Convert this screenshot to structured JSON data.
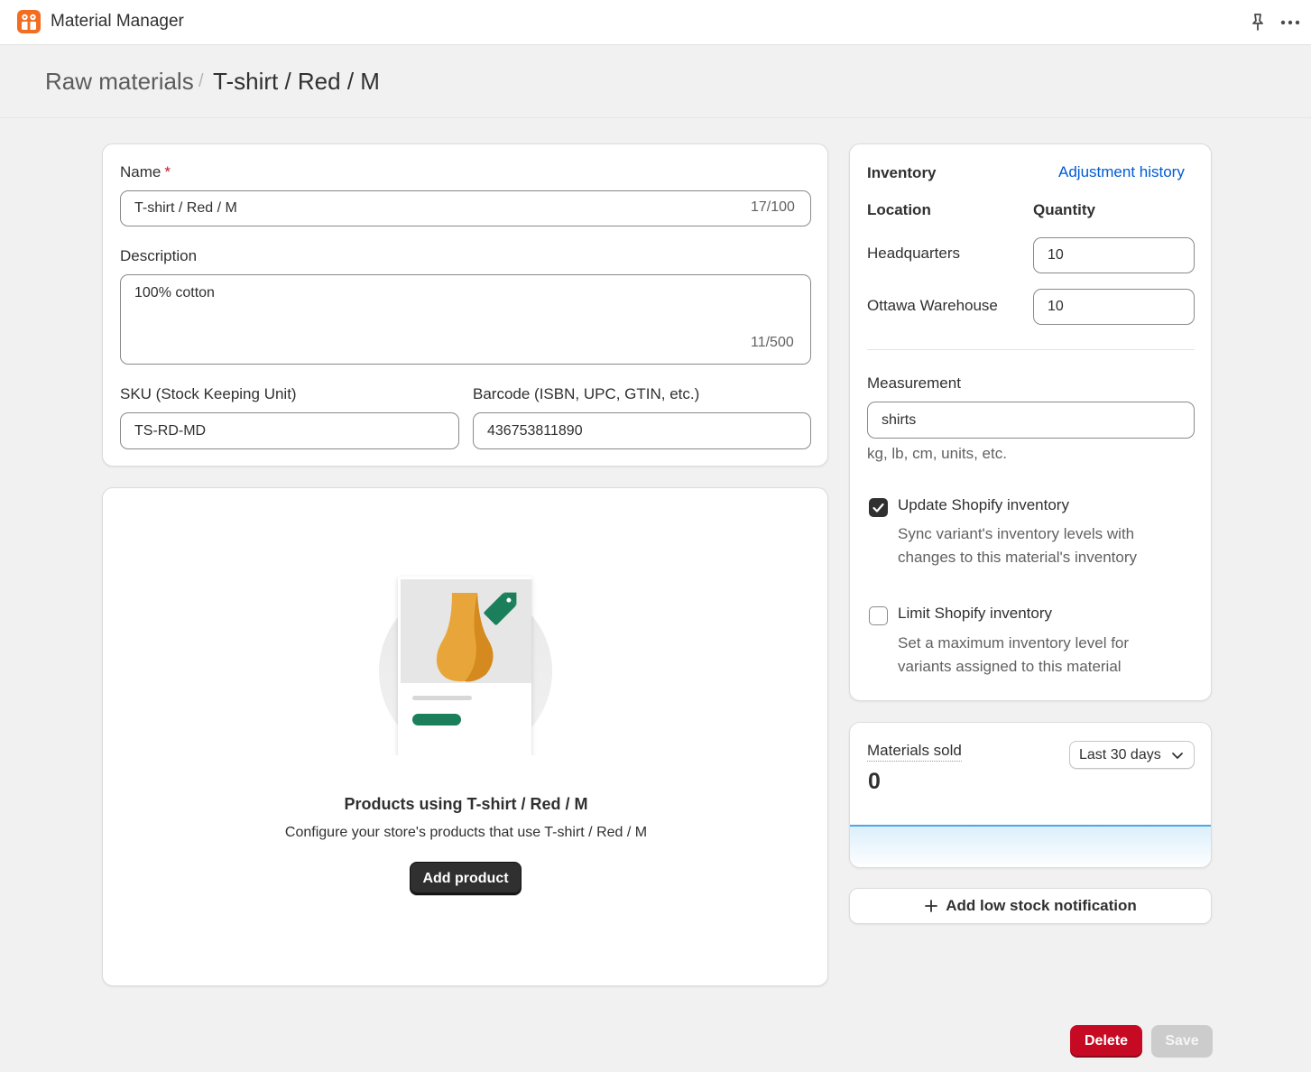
{
  "app": {
    "title": "Material Manager"
  },
  "breadcrumb": {
    "parent": "Raw materials",
    "separator": "/",
    "current": "T-shirt / Red / M"
  },
  "details": {
    "name_label": "Name",
    "name_required": "*",
    "name_value": "T-shirt / Red / M",
    "name_counter": "17/100",
    "description_label": "Description",
    "description_value": "100% cotton",
    "description_counter": "11/500",
    "sku_label": "SKU (Stock Keeping Unit)",
    "sku_value": "TS-RD-MD",
    "barcode_label": "Barcode (ISBN, UPC, GTIN, etc.)",
    "barcode_value": "436753811890"
  },
  "products": {
    "title": "Products using T-shirt / Red / M",
    "description": "Configure your store's products that use T-shirt / Red / M",
    "add_button": "Add product"
  },
  "inventory": {
    "title": "Inventory",
    "history_link": "Adjustment history",
    "location_header": "Location",
    "quantity_header": "Quantity",
    "locations": [
      {
        "name": "Headquarters",
        "quantity": "10"
      },
      {
        "name": "Ottawa Warehouse",
        "quantity": "10"
      }
    ],
    "measurement_label": "Measurement",
    "measurement_value": "shirts",
    "measurement_hint": "kg, lb, cm, units, etc.",
    "update_label": "Update Shopify inventory",
    "update_checked": true,
    "update_help_line1": "Sync variant's inventory levels with",
    "update_help_line2": "changes to this material's inventory",
    "limit_label": "Limit Shopify inventory",
    "limit_checked": false,
    "limit_help_line1": "Set a maximum inventory level for",
    "limit_help_line2": "variants assigned to this material"
  },
  "sold": {
    "title": "Materials sold",
    "value": "0",
    "period": "Last 30 days"
  },
  "notification": {
    "label": "Add low stock notification"
  },
  "footer": {
    "delete_label": "Delete",
    "save_label": "Save"
  },
  "colors": {
    "accent": "#005bd3",
    "danger": "#c70a24",
    "brand": "#f26d21",
    "tag": "#1a7f5a"
  }
}
